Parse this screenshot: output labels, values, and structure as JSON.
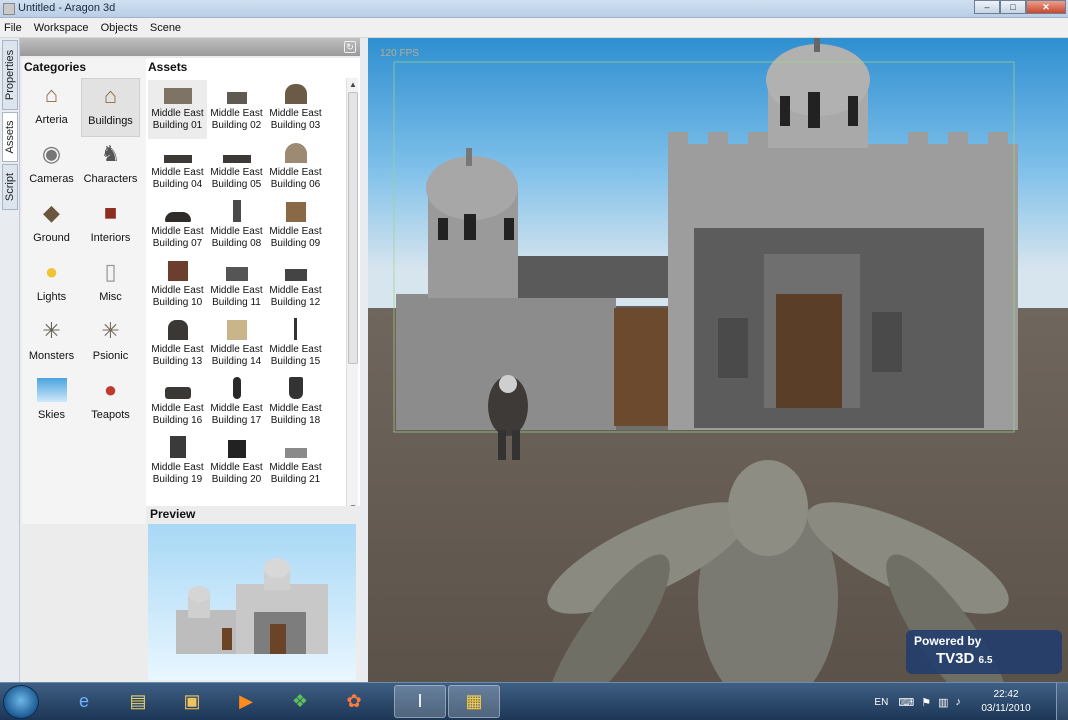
{
  "window": {
    "title": "Untitled - Aragon 3d",
    "min": "–",
    "max": "□",
    "close": "✕"
  },
  "menu": [
    "File",
    "Workspace",
    "Objects",
    "Scene"
  ],
  "side_tabs": [
    "Properties",
    "Assets",
    "Script"
  ],
  "categories": {
    "title": "Categories",
    "items": [
      {
        "label": "Arteria",
        "icon": "house-icon"
      },
      {
        "label": "Buildings",
        "icon": "building-icon"
      },
      {
        "label": "Cameras",
        "icon": "camera-icon"
      },
      {
        "label": "Characters",
        "icon": "character-icon"
      },
      {
        "label": "Ground",
        "icon": "ground-icon"
      },
      {
        "label": "Interiors",
        "icon": "interior-icon"
      },
      {
        "label": "Lights",
        "icon": "bulb-icon"
      },
      {
        "label": "Misc",
        "icon": "cup-icon"
      },
      {
        "label": "Monsters",
        "icon": "spider-icon"
      },
      {
        "label": "Psionic",
        "icon": "spider-icon"
      },
      {
        "label": "Skies",
        "icon": "sky-icon"
      },
      {
        "label": "Teapots",
        "icon": "teapot-icon"
      }
    ]
  },
  "assets": {
    "title": "Assets",
    "items": [
      {
        "l1": "Middle East",
        "l2": "Building 01"
      },
      {
        "l1": "Middle East",
        "l2": "Building 02"
      },
      {
        "l1": "Middle East",
        "l2": "Building 03"
      },
      {
        "l1": "Middle East",
        "l2": "Building 04"
      },
      {
        "l1": "Middle East",
        "l2": "Building 05"
      },
      {
        "l1": "Middle East",
        "l2": "Building 06"
      },
      {
        "l1": "Middle East",
        "l2": "Building 07"
      },
      {
        "l1": "Middle East",
        "l2": "Building 08"
      },
      {
        "l1": "Middle East",
        "l2": "Building 09"
      },
      {
        "l1": "Middle East",
        "l2": "Building 10"
      },
      {
        "l1": "Middle East",
        "l2": "Building 11"
      },
      {
        "l1": "Middle East",
        "l2": "Building 12"
      },
      {
        "l1": "Middle East",
        "l2": "Building 13"
      },
      {
        "l1": "Middle East",
        "l2": "Building 14"
      },
      {
        "l1": "Middle East",
        "l2": "Building 15"
      },
      {
        "l1": "Middle East",
        "l2": "Building 16"
      },
      {
        "l1": "Middle East",
        "l2": "Building 17"
      },
      {
        "l1": "Middle East",
        "l2": "Building 18"
      },
      {
        "l1": "Middle East",
        "l2": "Building 19"
      },
      {
        "l1": "Middle East",
        "l2": "Building 20"
      },
      {
        "l1": "Middle East",
        "l2": "Building 21"
      }
    ]
  },
  "preview": {
    "title": "Preview"
  },
  "viewport": {
    "fps": "120 FPS"
  },
  "tv3d": {
    "powered": "Powered by",
    "brand": "TV3D",
    "version": "6.5"
  },
  "taskbar": {
    "lang": "EN",
    "time": "22:42",
    "date": "03/11/2010"
  },
  "colors": {
    "accent": "#1c3656",
    "sky_top": "#2f8fd0",
    "ground": "#6e665c"
  }
}
